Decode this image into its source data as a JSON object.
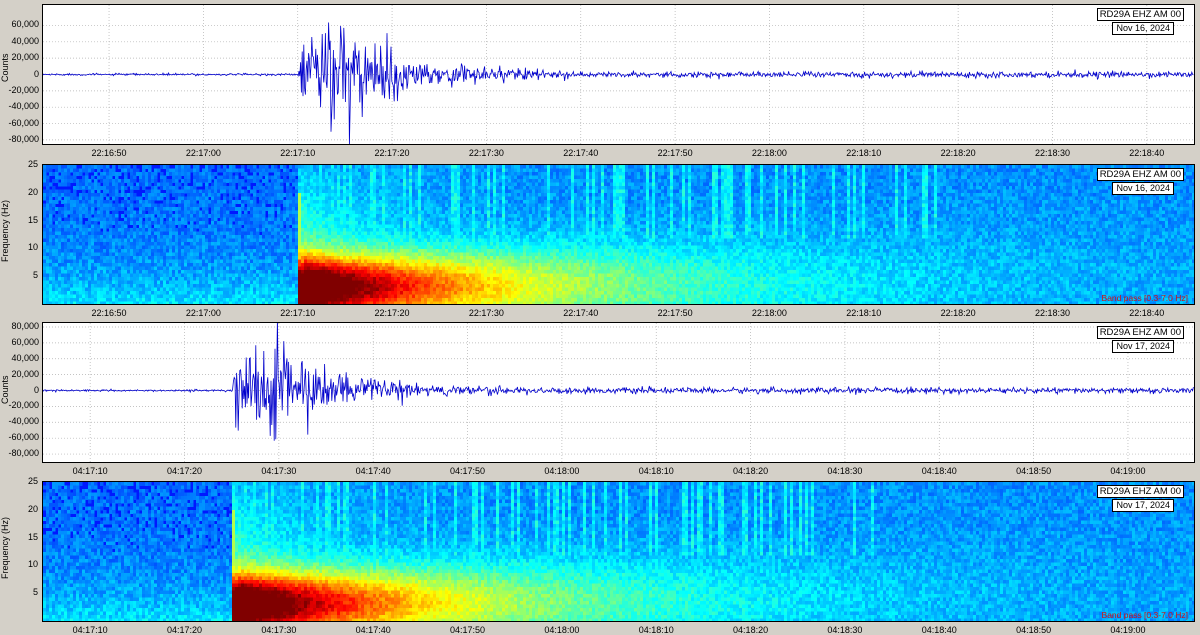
{
  "colors": {
    "trace": "#0000cc",
    "grid": "#b0b0b0",
    "bandpass_text": "#d01010"
  },
  "panels": {
    "p1": {
      "station": "RD29A EHZ AM 00",
      "date": "Nov 16, 2024",
      "ylabel": "Counts"
    },
    "p2": {
      "station": "RD29A EHZ AM 00",
      "date": "Nov 16, 2024",
      "ylabel": "Frequency (Hz)",
      "bandpass": "Band pass [0.3-7.0 Hz]"
    },
    "p3": {
      "station": "RD29A EHZ AM 00",
      "date": "Nov 17, 2024",
      "ylabel": "Counts"
    },
    "p4": {
      "station": "RD29A EHZ AM 00",
      "date": "Nov 17, 2024",
      "ylabel": "Frequency (Hz)",
      "bandpass": "Band pass [0.3-7.0 Hz]"
    }
  },
  "chart_data": [
    {
      "type": "line",
      "title": "RD29A EHZ AM 00",
      "date": "Nov 16, 2024",
      "ylabel": "Counts",
      "ylim": [
        -85000,
        85000
      ],
      "yticks": [
        "60,000",
        "40,000",
        "20,000",
        "0",
        "-20,000",
        "-40,000",
        "-60,000",
        "-80,000"
      ],
      "ytick_values": [
        60000,
        40000,
        20000,
        0,
        -20000,
        -40000,
        -60000,
        -80000
      ],
      "xticks": [
        "22:16:50",
        "22:17:00",
        "22:17:10",
        "22:17:20",
        "22:17:30",
        "22:17:40",
        "22:17:50",
        "22:18:00",
        "22:18:10",
        "22:18:20",
        "22:18:30",
        "22:18:40"
      ],
      "x_range": [
        "22:16:43",
        "22:18:45"
      ],
      "onset": "22:17:10",
      "peak_amplitude": 80000,
      "grid": true
    },
    {
      "type": "heatmap",
      "title": "RD29A EHZ AM 00",
      "date": "Nov 16, 2024",
      "ylabel": "Frequency (Hz)",
      "ylim": [
        0,
        25
      ],
      "yticks": [
        "25",
        "20",
        "15",
        "10",
        "5"
      ],
      "ytick_values": [
        25,
        20,
        15,
        10,
        5
      ],
      "xticks": [
        "22:16:50",
        "22:17:00",
        "22:17:10",
        "22:17:20",
        "22:17:30",
        "22:17:40",
        "22:17:50",
        "22:18:00",
        "22:18:10",
        "22:18:20",
        "22:18:30",
        "22:18:40"
      ],
      "x_range": [
        "22:16:43",
        "22:18:45"
      ],
      "onset": "22:17:10",
      "note": "Band pass [0.3-7.0 Hz]"
    },
    {
      "type": "line",
      "title": "RD29A EHZ AM 00",
      "date": "Nov 17, 2024",
      "ylabel": "Counts",
      "ylim": [
        -90000,
        85000
      ],
      "yticks": [
        "80,000",
        "60,000",
        "40,000",
        "20,000",
        "0",
        "-20,000",
        "-40,000",
        "-60,000",
        "-80,000"
      ],
      "ytick_values": [
        80000,
        60000,
        40000,
        20000,
        0,
        -20000,
        -40000,
        -60000,
        -80000
      ],
      "xticks": [
        "04:17:10",
        "04:17:20",
        "04:17:30",
        "04:17:40",
        "04:17:50",
        "04:18:00",
        "04:18:10",
        "04:18:20",
        "04:18:30",
        "04:18:40",
        "04:18:50",
        "04:19:00"
      ],
      "x_range": [
        "04:17:05",
        "04:19:07"
      ],
      "onset": "04:17:25",
      "peak_amplitude": 85000,
      "grid": true
    },
    {
      "type": "heatmap",
      "title": "RD29A EHZ AM 00",
      "date": "Nov 17, 2024",
      "ylabel": "Frequency (Hz)",
      "ylim": [
        0,
        25
      ],
      "yticks": [
        "25",
        "20",
        "15",
        "10",
        "5"
      ],
      "ytick_values": [
        25,
        20,
        15,
        10,
        5
      ],
      "xticks": [
        "04:17:10",
        "04:17:20",
        "04:17:30",
        "04:17:40",
        "04:17:50",
        "04:18:00",
        "04:18:10",
        "04:18:20",
        "04:18:30",
        "04:18:40",
        "04:18:50",
        "04:19:00"
      ],
      "x_range": [
        "04:17:05",
        "04:19:07"
      ],
      "onset": "04:17:25",
      "note": "Band pass [0.3-7.0 Hz]"
    }
  ]
}
